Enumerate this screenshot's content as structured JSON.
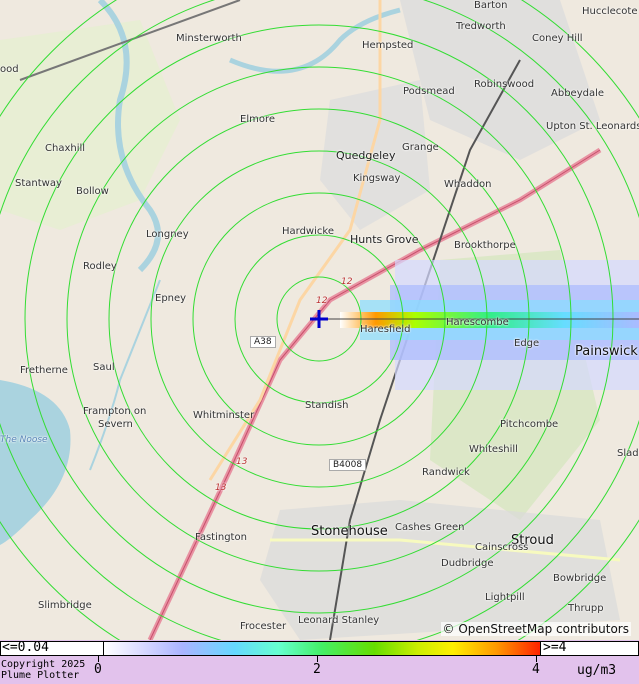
{
  "map": {
    "source_marker": "cross-marker",
    "place_labels": [
      {
        "name": "Barton"
      },
      {
        "name": "Hucclecote"
      },
      {
        "name": "Minsterworth"
      },
      {
        "name": "Hempsted"
      },
      {
        "name": "Tredworth"
      },
      {
        "name": "Coney Hill"
      },
      {
        "name": "ood"
      },
      {
        "name": "Podsmead"
      },
      {
        "name": "Robinswood"
      },
      {
        "name": "Abbeydale"
      },
      {
        "name": "Elmore"
      },
      {
        "name": "Upton St. Leonards"
      },
      {
        "name": "Chaxhill"
      },
      {
        "name": "Quedgeley"
      },
      {
        "name": "Grange"
      },
      {
        "name": "Stantway"
      },
      {
        "name": "Kingsway"
      },
      {
        "name": "Whaddon"
      },
      {
        "name": "Bollow"
      },
      {
        "name": "Hardwicke"
      },
      {
        "name": "Longney"
      },
      {
        "name": "Hunts Grove"
      },
      {
        "name": "Brookthorpe"
      },
      {
        "name": "Rodley"
      },
      {
        "name": "Epney"
      },
      {
        "name": "Haresfield"
      },
      {
        "name": "Harescombe"
      },
      {
        "name": "Edge"
      },
      {
        "name": "Painswick"
      },
      {
        "name": "Fretherne"
      },
      {
        "name": "Saul"
      },
      {
        "name": "Frampton on"
      },
      {
        "name": "Severn"
      },
      {
        "name": "Whitminster"
      },
      {
        "name": "Standish"
      },
      {
        "name": "Pitchcombe"
      },
      {
        "name": "Whiteshill"
      },
      {
        "name": "Slad"
      },
      {
        "name": "The Noose"
      },
      {
        "name": "Randwick"
      },
      {
        "name": "Stonehouse"
      },
      {
        "name": "Cashes Green"
      },
      {
        "name": "Stroud"
      },
      {
        "name": "Cainscross"
      },
      {
        "name": "Dudbridge"
      },
      {
        "name": "Fastington"
      },
      {
        "name": "Bowbridge"
      },
      {
        "name": "Lightpill"
      },
      {
        "name": "Slimbridge"
      },
      {
        "name": "Thrupp"
      },
      {
        "name": "Frocester"
      },
      {
        "name": "Leonard Stanley"
      }
    ],
    "road_labels": [
      "A38",
      "B4008"
    ],
    "road_numbers": [
      "12",
      "12",
      "13",
      "13"
    ],
    "attribution": "© OpenStreetMap contributors",
    "contour_rings": 9
  },
  "legend": {
    "low_label": "<=0.04",
    "high_label": ">=4",
    "ticks": [
      "0",
      "2",
      "4"
    ],
    "unit": "ug/m3",
    "copyright_line1": "Copyright 2025",
    "copyright_line2": "Plume Plotter"
  },
  "colors": {
    "contour": "#33dd33",
    "source_marker": "#0000cc",
    "legend_bg": "#e2c2ec"
  }
}
